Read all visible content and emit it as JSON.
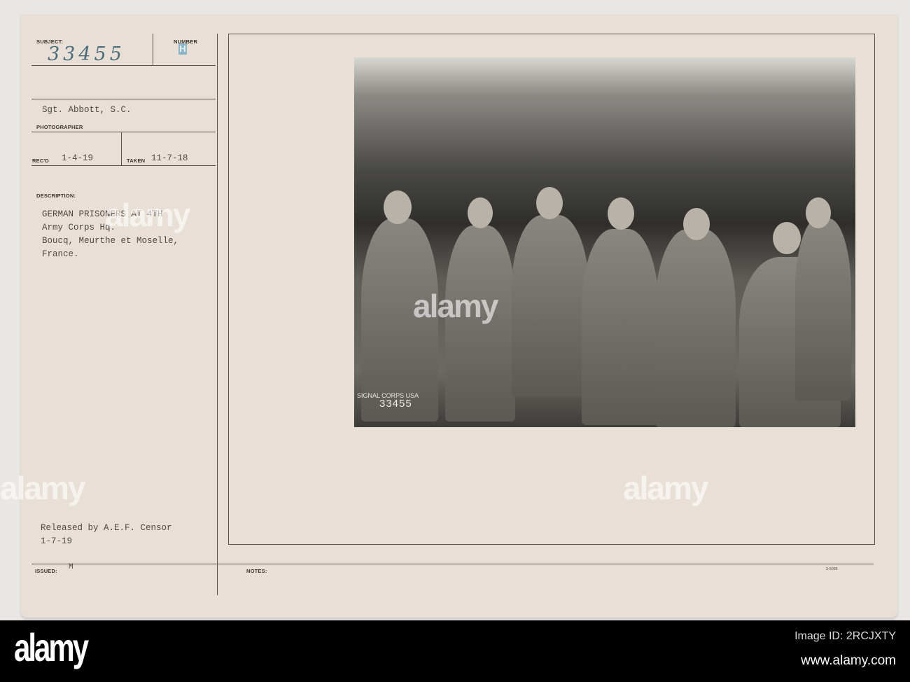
{
  "card": {
    "subject_label": "SUBJECT:",
    "subject_value": "33455",
    "number_label": "NUMBER",
    "number_value": "H",
    "photographer_value": "Sgt. Abbott, S.C.",
    "photographer_label": "PHOTOGRAPHER",
    "recd_label": "REC'D",
    "recd_value": "1-4-19",
    "taken_label": "TAKEN",
    "taken_value": "11-7-18",
    "description_label": "DESCRIPTION:",
    "description_lines": [
      "GERMAN PRISONERS AT 4TH",
      "Army Corps Hq.",
      "Boucq, Meurthe et Moselle,",
      "France."
    ],
    "released_lines": [
      "Released by A.E.F. Censor",
      "1-7-19"
    ],
    "issued_label": "ISSUED:",
    "issued_value": "M",
    "notes_label": "NOTES:",
    "form_number": "3-5005"
  },
  "photo": {
    "stamp_text": "SIGNAL CORPS USA",
    "stamp_number": "33455"
  },
  "watermark": "alamy",
  "footer": {
    "logo": "alamy",
    "image_id": "Image ID: 2RCJXTY",
    "url": "www.alamy.com"
  }
}
